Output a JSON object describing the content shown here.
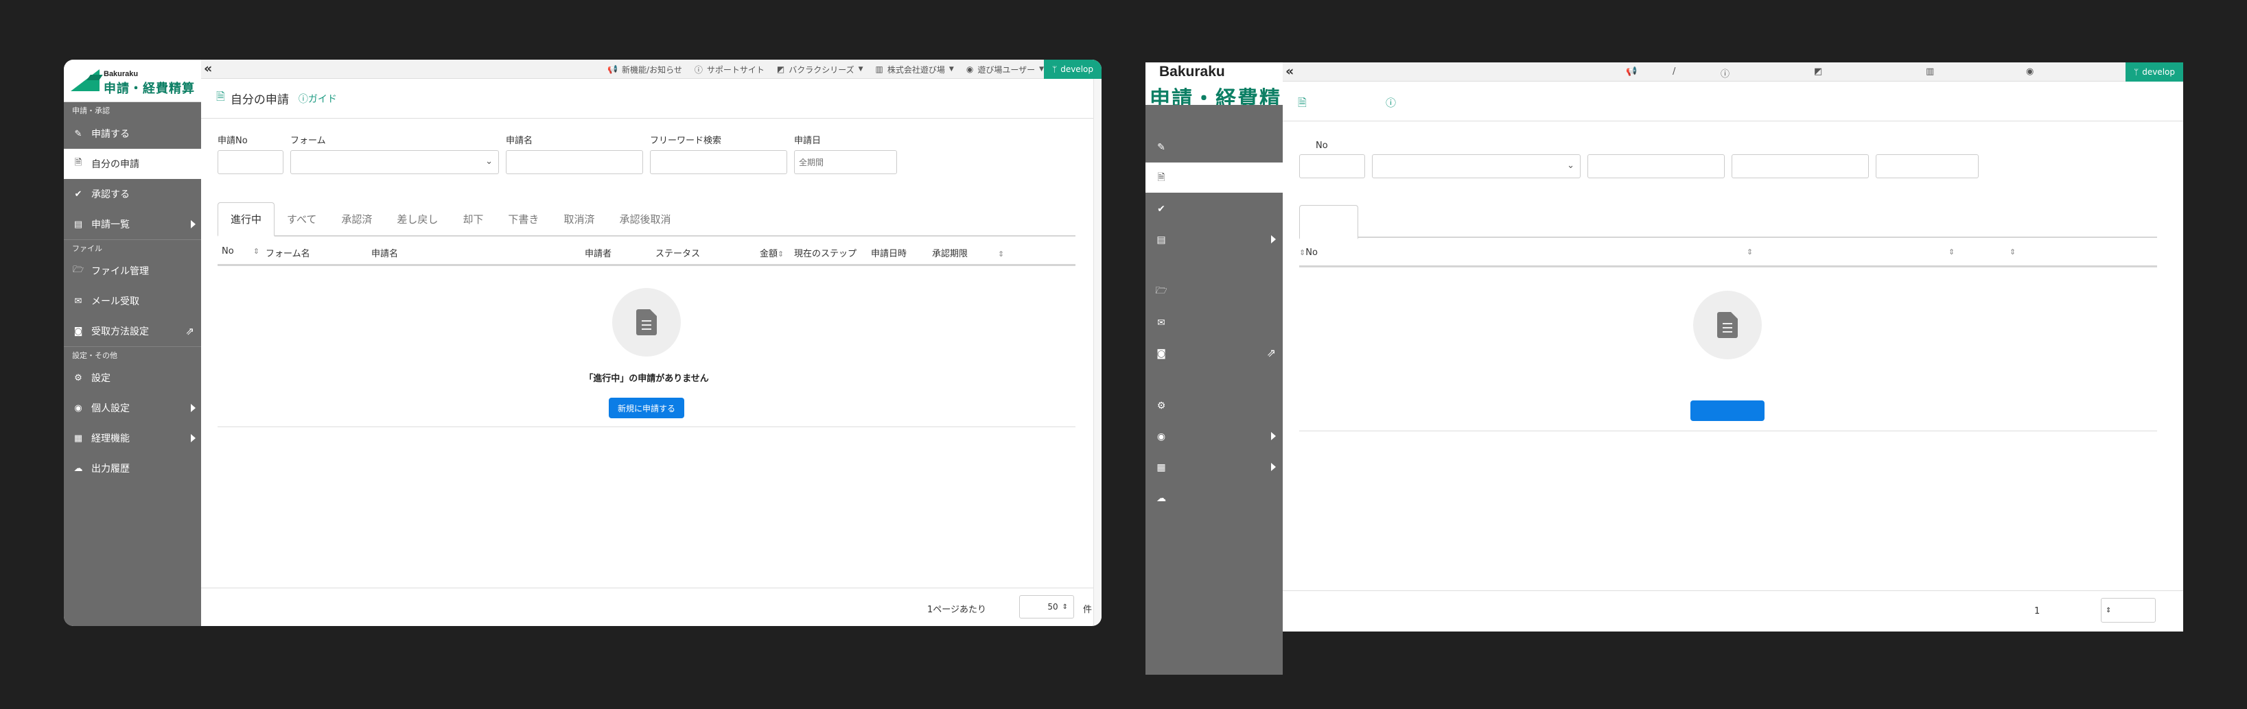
{
  "panel1": {
    "logo": {
      "brand": "Bakuraku",
      "product": "申請・経費精算"
    },
    "sidebar": {
      "sections": [
        "申請・承認",
        "ファイル",
        "設定・その他"
      ],
      "items": [
        {
          "label": "申請する",
          "icon": "edit-icon"
        },
        {
          "label": "自分の申請",
          "icon": "document-icon",
          "active": true
        },
        {
          "label": "承認する",
          "icon": "check-circle-icon"
        },
        {
          "label": "申請一覧",
          "icon": "clipboard-icon",
          "submenu": true
        },
        {
          "label": "ファイル管理",
          "icon": "folder-open-icon"
        },
        {
          "label": "メール受取",
          "icon": "envelope-icon"
        },
        {
          "label": "受取方法設定",
          "icon": "camera-icon",
          "external": true
        },
        {
          "label": "設定",
          "icon": "gear-icon"
        },
        {
          "label": "個人設定",
          "icon": "user-circle-icon",
          "submenu": true
        },
        {
          "label": "経理機能",
          "icon": "calculator-icon",
          "submenu": true
        },
        {
          "label": "出力履歴",
          "icon": "cloud-download-icon"
        }
      ]
    },
    "topbar": {
      "collapse": "«",
      "news": "新機能/お知らせ",
      "support": "サポートサイト",
      "series": "バクラクシリーズ",
      "company": "株式会社遊び場",
      "user": "遊び場ユーザー",
      "develop": "develop"
    },
    "header": {
      "title": "自分の申請",
      "guide": "ガイド"
    },
    "filters": {
      "no": "申請No",
      "form": "フォーム",
      "name": "申請名",
      "keyword": "フリーワード検索",
      "date": "申請日",
      "date_placeholder": "全期間"
    },
    "tabs": [
      "進行中",
      "すべて",
      "承認済",
      "差し戻し",
      "却下",
      "下書き",
      "取消済",
      "承認後取消"
    ],
    "columns": [
      "No",
      "フォーム名",
      "申請名",
      "申請者",
      "ステータス",
      "金額",
      "現在のステップ",
      "申請日時",
      "承認期限"
    ],
    "empty": {
      "message": "「進行中」の申請がありません",
      "button": "新規に申請する"
    },
    "footer": {
      "per_page_label": "1ページあたり",
      "per_page_value": "50",
      "unit": "件"
    }
  },
  "panel2": {
    "logo": {
      "brand": "Bakuraku",
      "product": "申請・経費精"
    },
    "topbar": {
      "collapse": "«",
      "slash": "/",
      "develop": "develop"
    },
    "filters": {
      "no": "No"
    },
    "columns": {
      "no": "No"
    },
    "footer": {
      "page": "1"
    }
  },
  "colors": {
    "accent": "#15a584",
    "brand_green": "#0c7f64",
    "sidebar": "#6b6b6b",
    "primary_button": "#0b7de6",
    "background": "#202020"
  }
}
